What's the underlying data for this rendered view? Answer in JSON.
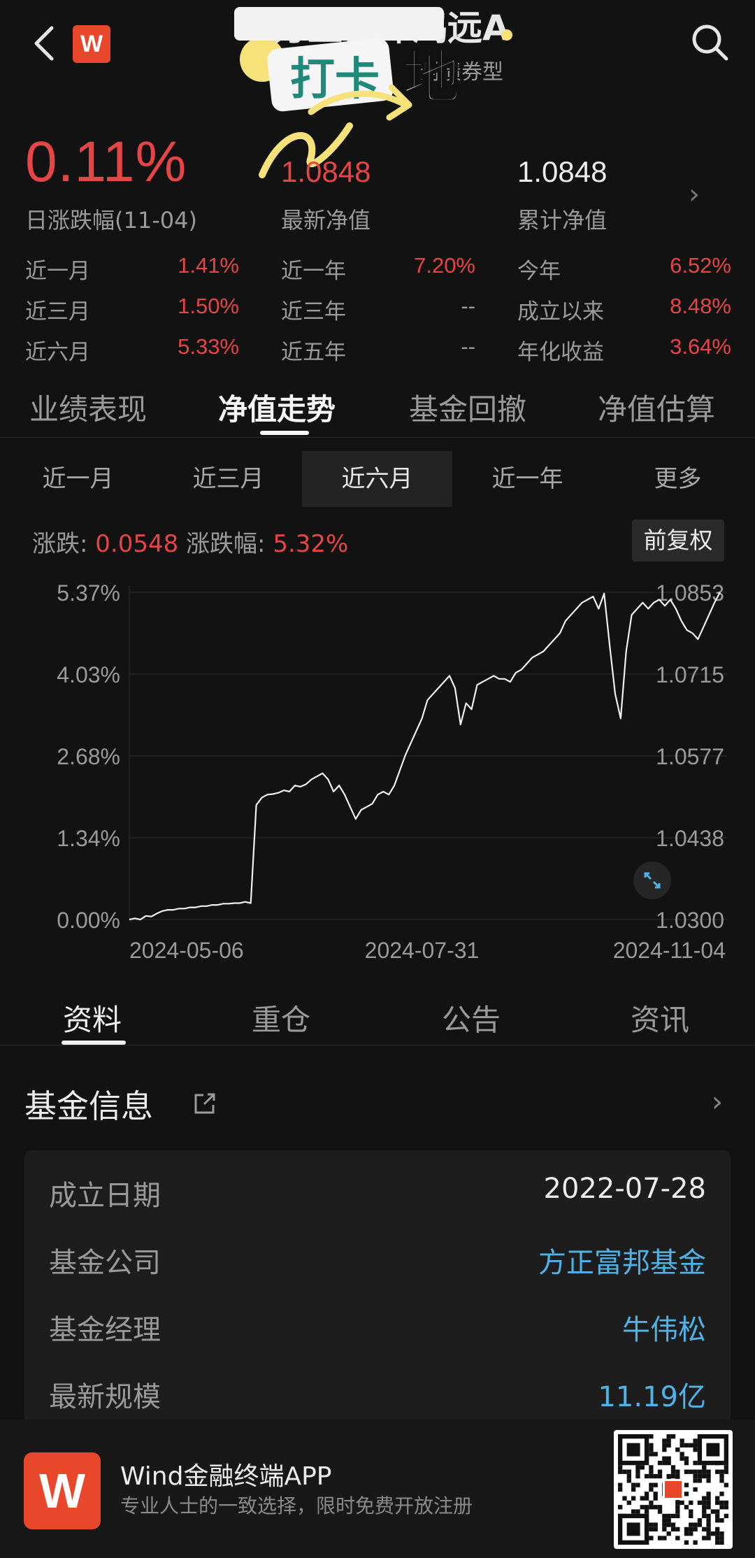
{
  "header": {
    "back_icon": "back-arrow-icon",
    "logo_letter": "W",
    "title_partial": "方正富邦鸿远A",
    "fund_type_partial": "附债券型",
    "search_icon": "search-icon",
    "sticker_text": "打卡"
  },
  "summary": {
    "daily_change": "0.11%",
    "daily_change_label": "日涨跌幅(11-04)",
    "latest_nav": "1.0848",
    "latest_nav_label": "最新净值",
    "cum_nav": "1.0848",
    "cum_nav_label": "累计净值"
  },
  "performance": [
    {
      "label": "近一月",
      "value": "1.41%"
    },
    {
      "label": "近一年",
      "value": "7.20%"
    },
    {
      "label": "今年",
      "value": "6.52%"
    },
    {
      "label": "近三月",
      "value": "1.50%"
    },
    {
      "label": "近三年",
      "value": "--"
    },
    {
      "label": "成立以来",
      "value": "8.48%"
    },
    {
      "label": "近六月",
      "value": "5.33%"
    },
    {
      "label": "近五年",
      "value": "--"
    },
    {
      "label": "年化收益",
      "value": "3.64%"
    }
  ],
  "main_tabs": [
    "业绩表现",
    "净值走势",
    "基金回撤",
    "净值估算"
  ],
  "period_tabs": [
    "近一月",
    "近三月",
    "近六月",
    "近一年",
    "更多"
  ],
  "change": {
    "abs_label": "涨跌: ",
    "abs_value": "0.0548",
    "pct_label": "涨跌幅: ",
    "pct_value": "5.32%",
    "adjust_button": "前复权"
  },
  "chart_data": {
    "type": "line",
    "y_left_ticks": [
      "5.37%",
      "4.03%",
      "2.68%",
      "1.34%",
      "0.00%"
    ],
    "y_right_ticks": [
      "1.0853",
      "1.0715",
      "1.0577",
      "1.0438",
      "1.0300"
    ],
    "x_ticks": [
      "2024-05-06",
      "2024-07-31",
      "2024-11-04"
    ],
    "ylim_pct": [
      0.0,
      5.37
    ],
    "series": [
      {
        "values": [
          0.0,
          0.02,
          0.0,
          0.06,
          0.05,
          0.1,
          0.14,
          0.16,
          0.16,
          0.18,
          0.18,
          0.2,
          0.2,
          0.22,
          0.22,
          0.24,
          0.24,
          0.26,
          0.26,
          0.27,
          0.27,
          0.29,
          0.27,
          1.88,
          2.0,
          2.05,
          2.06,
          2.08,
          2.12,
          2.1,
          2.2,
          2.18,
          2.22,
          2.3,
          2.35,
          2.4,
          2.3,
          2.1,
          2.2,
          2.05,
          1.85,
          1.65,
          1.8,
          1.85,
          1.9,
          2.05,
          2.1,
          2.05,
          2.2,
          2.45,
          2.7,
          2.9,
          3.1,
          3.3,
          3.6,
          3.7,
          3.8,
          3.9,
          4.0,
          3.8,
          3.2,
          3.55,
          3.45,
          3.85,
          3.9,
          3.95,
          4.0,
          3.95,
          3.95,
          3.9,
          4.05,
          4.1,
          4.2,
          4.3,
          4.35,
          4.4,
          4.5,
          4.6,
          4.7,
          4.9,
          5.0,
          5.1,
          5.2,
          5.25,
          5.3,
          5.1,
          5.35,
          4.5,
          3.7,
          3.3,
          4.4,
          5.0,
          5.1,
          5.2,
          5.1,
          5.2,
          5.25,
          5.15,
          5.25,
          5.1,
          4.9,
          4.75,
          4.7,
          4.6,
          4.8,
          5.0,
          5.2,
          5.37
        ]
      }
    ]
  },
  "info_tabs": [
    "资料",
    "重仓",
    "公告",
    "资讯"
  ],
  "fund_info": {
    "title": "基金信息",
    "rows": [
      {
        "key": "成立日期",
        "value": "2022-07-28",
        "link": false
      },
      {
        "key": "基金公司",
        "value": "方正富邦基金",
        "link": true
      },
      {
        "key": "基金经理",
        "value": "牛伟松",
        "link": true
      },
      {
        "key": "最新规模",
        "value": "11.19亿",
        "link": true
      }
    ]
  },
  "promo": {
    "logo_letter": "W",
    "title": "Wind金融终端APP",
    "subtitle": "专业人士的一致选择，限时免费开放注册"
  }
}
